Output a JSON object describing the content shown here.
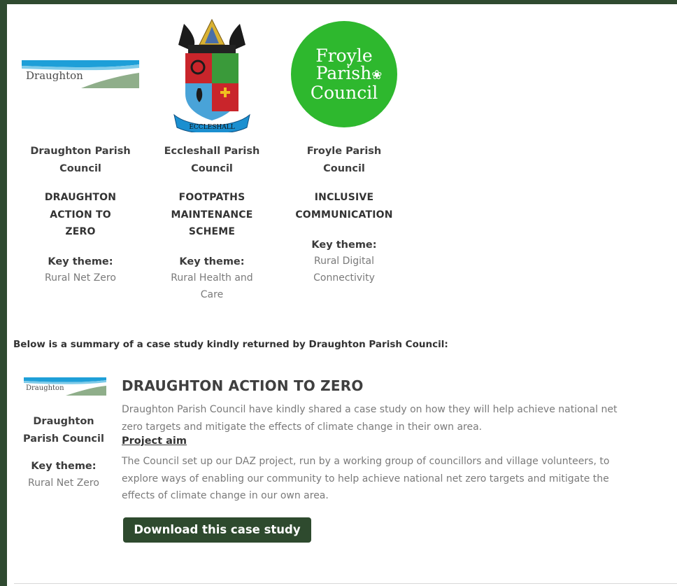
{
  "cards": [
    {
      "logo_text": "Draughton",
      "council_line1": "Draughton Parish",
      "council_line2": "Council",
      "project_line1": "DRAUGHTON",
      "project_line2": "ACTION TO",
      "project_line3": "ZERO",
      "key_theme_label": "Key theme:",
      "key_theme_line1": "Rural Net Zero",
      "key_theme_line2": ""
    },
    {
      "logo_text": "ECCLESHALL",
      "council_line1": "Eccleshall Parish",
      "council_line2": "Council",
      "project_line1": "FOOTPATHS",
      "project_line2": "MAINTENANCE",
      "project_line3": "SCHEME",
      "key_theme_label": "Key theme:",
      "key_theme_line1": "Rural Health and",
      "key_theme_line2": "Care"
    },
    {
      "logo_line1": "Froyle",
      "logo_line2": "Parish",
      "logo_line3": "Council",
      "council_line1": "Froyle Parish",
      "council_line2": "Council",
      "project_line1": "INCLUSIVE",
      "project_line2": "COMMUNICATION",
      "key_theme_label": "Key theme:",
      "key_theme_line1": "Rural Digital",
      "key_theme_line2": "Connectivity"
    }
  ],
  "summary_intro": "Below is a summary of a case study kindly returned by Draughton Parish Council:",
  "case_study": {
    "logo_text": "Draughton",
    "council_line1": "Draughton",
    "council_line2": "Parish Council",
    "key_theme_label": "Key theme:",
    "key_theme_value": "Rural Net Zero",
    "title": "DRAUGHTON ACTION TO ZERO",
    "intro_line1": "Draughton Parish Council have kindly shared a case study on how they will help achieve national net",
    "intro_line2": "zero targets and mitigate the effects of climate change in their own area.",
    "aim_heading": "Project aim",
    "aim_line1": "The Council set up our DAZ project, run by a working group of councillors and village volunteers, to",
    "aim_line2": "explore ways of enabling our community to help achieve national net zero targets and mitigate the",
    "aim_line3": "effects of climate change in our own area.",
    "download_label": "Download this case study"
  },
  "colors": {
    "frame": "#2f4a30",
    "button": "#2e4a2e",
    "froyle_green": "#2eb82e"
  }
}
